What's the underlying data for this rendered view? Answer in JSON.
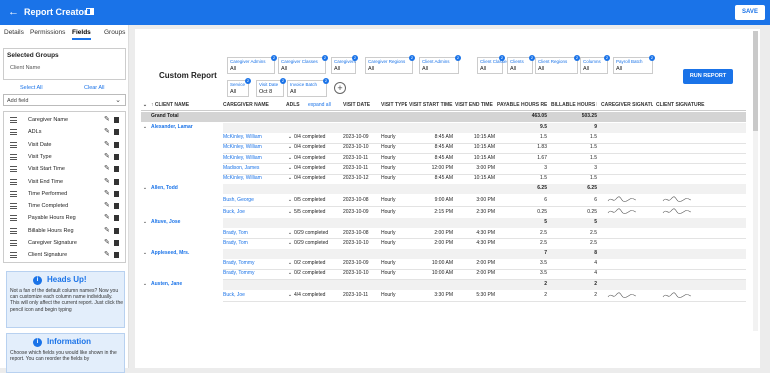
{
  "app": {
    "title": "Report Creator",
    "save_label": "SAVE"
  },
  "tabs": [
    "Details",
    "Permissions",
    "Fields",
    "Groups"
  ],
  "selected_groups": {
    "heading": "Selected Groups",
    "value": "Client Name"
  },
  "select_all": "Select All",
  "clear_all": "Clear All",
  "add_field": "Add field",
  "fields": [
    "Caregiver Name",
    "ADLs",
    "Visit Date",
    "Visit Type",
    "Visit Start Time",
    "Visit End Time",
    "Time Performed",
    "Time Completed",
    "Payable Hours Reg",
    "Billable Hours Reg",
    "Caregiver Signature",
    "Client Signature"
  ],
  "heads_up": {
    "title": "Heads Up!",
    "body": "Not a fan of the default column names? Now you can customize each column name individually. This will only affect the current report. Just click the pencil icon and begin typing"
  },
  "information": {
    "title": "Information",
    "body": "Choose which fields you would like shown in the report. You can reorder the fields by"
  },
  "report": {
    "title": "Custom Report",
    "run_label": "RUN REPORT"
  },
  "filters": [
    {
      "label": "Caregiver Admins",
      "value": "All",
      "badge": "2"
    },
    {
      "label": "Caregiver Classes",
      "value": "All",
      "badge": "2"
    },
    {
      "label": "Caregivers",
      "value": "All",
      "badge": "2"
    },
    {
      "label": "Caregiver Regions",
      "value": "All",
      "badge": "2"
    },
    {
      "label": "Client Admins",
      "value": "All",
      "badge": "2"
    },
    {
      "label": "Client Classes",
      "value": "All",
      "badge": "2"
    },
    {
      "label": "Clients",
      "value": "All",
      "badge": "2"
    },
    {
      "label": "Client Regions",
      "value": "All",
      "badge": "2"
    },
    {
      "label": "Columns",
      "value": "All",
      "badge": "2"
    },
    {
      "label": "Payroll Batch",
      "value": "All",
      "badge": "2"
    },
    {
      "label": "Service",
      "value": "All",
      "badge": "2"
    },
    {
      "label": "Visit Date",
      "value": "Oct 8",
      "badge": "2"
    },
    {
      "label": "Invoice Batch",
      "value": "All",
      "badge": "2"
    }
  ],
  "table": {
    "columns": [
      "↑ CLIENT NAME",
      "CAREGIVER NAME",
      "ADLS",
      "expand all",
      "VISIT DATE",
      "VISIT TYPE",
      "VISIT START TIME",
      "VISIT END TIME",
      "PAYABLE HOURS REG",
      "BILLABLE HOURS REG",
      "CAREGIVER SIGNATURE",
      "CLIENT SIGNATURE"
    ],
    "grand_total": {
      "label": "Grand Total",
      "payable": "463.05",
      "billable": "503.25"
    },
    "groups": [
      {
        "client": "Alexander, Lamar",
        "payable": "9.5",
        "billable": "9",
        "rows": [
          [
            "McKinley, William",
            "0/4 completed",
            "2023-10-09",
            "Hourly",
            "8:45 AM",
            "10:15 AM",
            "1.5",
            "1.5"
          ],
          [
            "McKinley, William",
            "0/4 completed",
            "2023-10-10",
            "Hourly",
            "8:45 AM",
            "10:15 AM",
            "1.83",
            "1.5"
          ],
          [
            "McKinley, William",
            "0/4 completed",
            "2023-10-11",
            "Hourly",
            "8:45 AM",
            "10:15 AM",
            "1.67",
            "1.5"
          ],
          [
            "Madison, James",
            "0/4 completed",
            "2023-10-11",
            "Hourly",
            "12:00 PM",
            "3:00 PM",
            "3",
            "3"
          ],
          [
            "McKinley, William",
            "0/4 completed",
            "2023-10-12",
            "Hourly",
            "8:45 AM",
            "10:15 AM",
            "1.5",
            "1.5"
          ]
        ]
      },
      {
        "client": "Allen, Todd",
        "payable": "6.25",
        "billable": "6.25",
        "rows": [
          [
            "Bush, George",
            "0/5 completed",
            "2023-10-08",
            "Hourly",
            "9:00 AM",
            "3:00 PM",
            "6",
            "6"
          ],
          [
            "Buck, Joe",
            "5/5 completed",
            "2023-10-09",
            "Hourly",
            "2:15 PM",
            "2:30 PM",
            "0.25",
            "0.25"
          ]
        ]
      },
      {
        "client": "Altuve, Jose",
        "payable": "5",
        "billable": "5",
        "rows": [
          [
            "Brady, Tom",
            "0/29 completed",
            "2023-10-08",
            "Hourly",
            "2:00 PM",
            "4:30 PM",
            "2.5",
            "2.5"
          ],
          [
            "Brady, Tom",
            "0/29 completed",
            "2023-10-10",
            "Hourly",
            "2:00 PM",
            "4:30 PM",
            "2.5",
            "2.5"
          ]
        ]
      },
      {
        "client": "Appleseed, Mrs.",
        "payable": "7",
        "billable": "8",
        "rows": [
          [
            "Brady, Tommy",
            "0/2 completed",
            "2023-10-09",
            "Hourly",
            "10:00 AM",
            "2:00 PM",
            "3.5",
            "4"
          ],
          [
            "Brady, Tommy",
            "0/2 completed",
            "2023-10-10",
            "Hourly",
            "10:00 AM",
            "2:00 PM",
            "3.5",
            "4"
          ]
        ]
      },
      {
        "client": "Austen, Jane",
        "payable": "2",
        "billable": "2",
        "rows": [
          [
            "Buck, Joe",
            "4/4 completed",
            "2023-10-11",
            "Hourly",
            "3:30 PM",
            "5:30 PM",
            "2",
            "2"
          ]
        ]
      }
    ]
  },
  "colors": {
    "accent": "#1a73e8",
    "grand_total_bg": "#d4d4d4"
  },
  "icons": [
    "back-arrow-icon",
    "bookmark-icon",
    "drag-handle-icon",
    "pencil-icon",
    "trash-icon",
    "info-icon",
    "plus-icon",
    "chevron-down-icon",
    "sort-up-icon"
  ]
}
